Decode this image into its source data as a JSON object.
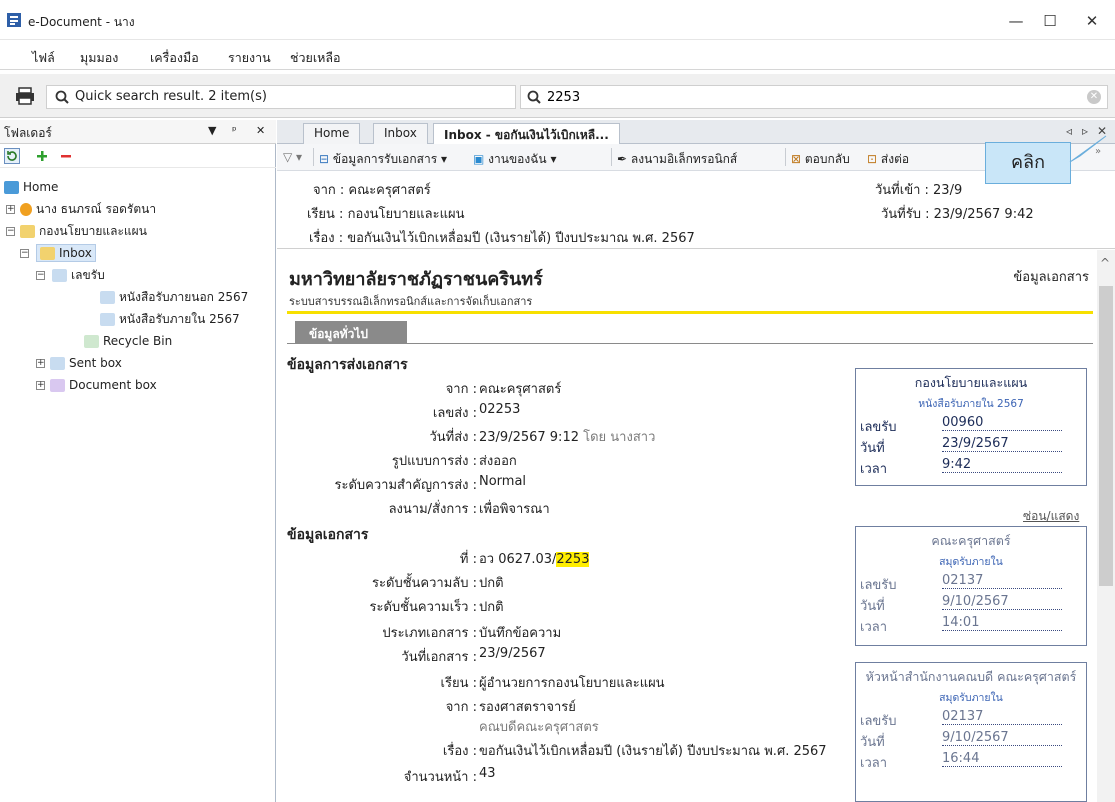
{
  "window": {
    "title": "e-Document - นาง",
    "minimize": "—",
    "maximize": "☐",
    "close": "✕"
  },
  "menu": [
    "ไฟล์",
    "มุมมอง",
    "เครื่องมือ",
    "รายงาน",
    "ช่วยเหลือ"
  ],
  "search": {
    "quick_label": "Quick search result. 2 item(s)",
    "query": "2253"
  },
  "left": {
    "title": "โฟลเดอร์",
    "pin": "ᵖ",
    "close": "✕",
    "tree": [
      {
        "label": "Home"
      },
      {
        "label": "นาง ธนภรณ์ รอดรัตนา"
      },
      {
        "label": "กองนโยบายและแผน"
      },
      {
        "label": "Inbox"
      },
      {
        "label": "เลขรับ"
      },
      {
        "label": "หนังสือรับภายนอก 2567"
      },
      {
        "label": "หนังสือรับภายใน 2567"
      },
      {
        "label": "Recycle Bin"
      },
      {
        "label": "Sent box"
      },
      {
        "label": "Document box"
      }
    ]
  },
  "tabs": [
    "Home",
    "Inbox",
    "Inbox - ขอกันเงินไว้เบิกเหลื..."
  ],
  "toolbar": {
    "receive": "ข้อมูลการรับเอกสาร",
    "mywork": "งานของฉัน",
    "sign": "ลงนามอิเล็กทรอนิกส์",
    "reply": "ตอบกลับ",
    "forward": "ส่งต่อ"
  },
  "header": {
    "from": "จาก : คณะครุศาสตร์",
    "to": "เรียน : กองนโยบายและแผน",
    "subject": "เรื่อง : ขอกันเงินไว้เบิกเหลื่อมปี (เงินรายได้) ปีงบประมาณ พ.ศ. 2567",
    "date_in": "วันที่เข้า : 23/9",
    "date_received": "วันที่รับ : 23/9/2567 9:42"
  },
  "doc": {
    "university": "มหาวิทยาลัยราชภัฏราชนครินทร์",
    "system": "ระบบสารบรรณอิเล็กทรอนิกส์และการจัดเก็บเอกสาร",
    "doc_info": "ข้อมูลเอกสาร",
    "general_tab": "ข้อมูลทั่วไป",
    "send_section": "ข้อมูลการส่งเอกสาร",
    "send_rows": [
      {
        "label": "จาก :",
        "value": "คณะครุศาสตร์"
      },
      {
        "label": "เลขส่ง :",
        "value": "02253"
      },
      {
        "label": "วันที่ส่ง :",
        "value": "23/9/2567 9:12",
        "extra": "โดย นางสาว"
      },
      {
        "label": "รูปแบบการส่ง :",
        "value": "ส่งออก"
      },
      {
        "label": "ระดับความสำคัญการส่ง :",
        "value": "Normal"
      },
      {
        "label": "ลงนาม/สั่งการ :",
        "value": "เพื่อพิจารณา"
      }
    ],
    "doc_section": "ข้อมูลเอกสาร",
    "doc_no_label": "ที่ :",
    "doc_no_prefix": "อว 0627.03/",
    "doc_no_highlight": "2253",
    "doc_rows": [
      {
        "label": "ระดับชั้นความลับ :",
        "value": "ปกติ"
      },
      {
        "label": "ระดับชั้นความเร็ว :",
        "value": "ปกติ"
      },
      {
        "label": "ประเภทเอกสาร :",
        "value": "บันทึกข้อความ"
      },
      {
        "label": "วันที่เอกสาร :",
        "value": "23/9/2567"
      },
      {
        "label": "เรียน :",
        "value": "ผู้อำนวยการกองนโยบายและแผน"
      },
      {
        "label": "จาก :",
        "value": "รองศาสตราจารย์"
      }
    ],
    "from_sub": "คณบดีคณะครุศาสตร",
    "subject_label": "เรื่อง :",
    "subject_value": "ขอกันเงินไว้เบิกเหลื่อมปี (เงินรายได้) ปีงบประมาณ พ.ศ. 2567",
    "pages_label": "จำนวนหน้า :",
    "pages_value": "43",
    "toggle": "ซ่อน/แสดง"
  },
  "boxes": [
    {
      "title": "กองนโยบายและแผน",
      "sub": "หนังสือรับภายใน 2567",
      "no_label": "เลขรับ",
      "no": "00960",
      "date_label": "วันที่",
      "date": "23/9/2567",
      "time_label": "เวลา",
      "time": "9:42"
    },
    {
      "title": "คณะครุศาสตร์",
      "sub": "สมุดรับภายใน",
      "no_label": "เลขรับ",
      "no": "02137",
      "date_label": "วันที่",
      "date": "9/10/2567",
      "time_label": "เวลา",
      "time": "14:01"
    },
    {
      "title": "หัวหน้าสำนักงานคณบดี คณะครุศาสตร์",
      "sub": "สมุดรับภายใน",
      "no_label": "เลขรับ",
      "no": "02137",
      "date_label": "วันที่",
      "date": "9/10/2567",
      "time_label": "เวลา",
      "time": "16:44"
    }
  ],
  "callout": "คลิก"
}
